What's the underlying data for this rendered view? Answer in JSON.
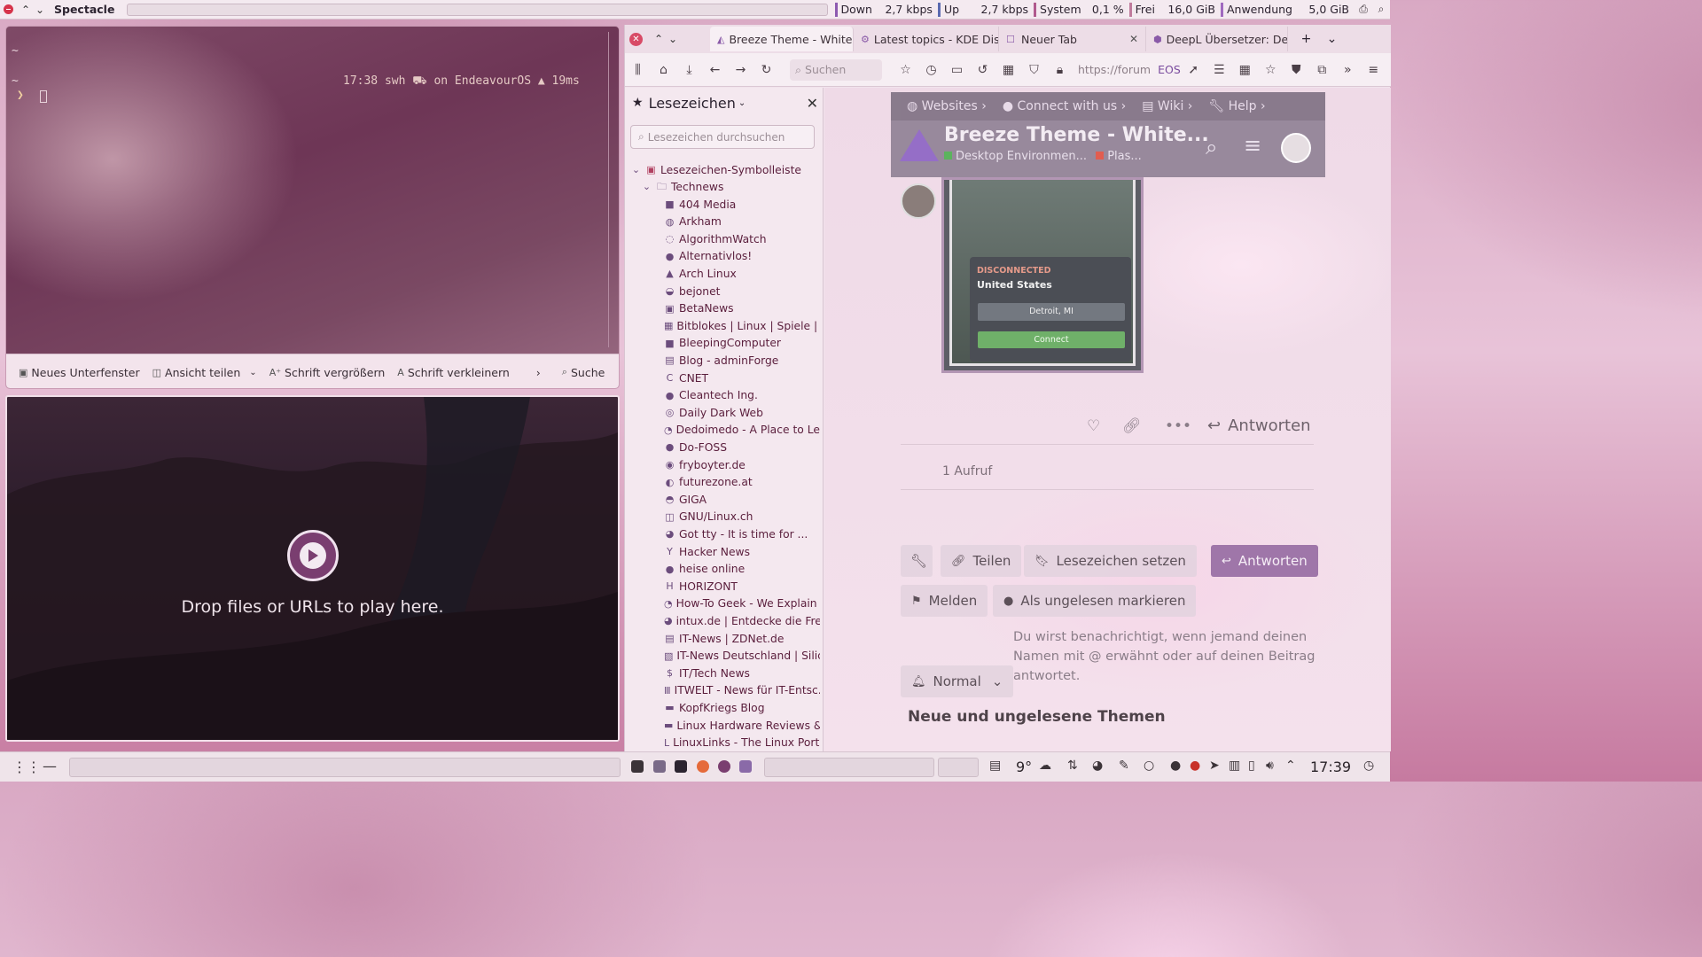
{
  "toppanel": {
    "title": "Spectacle",
    "segments": [
      {
        "label": "Down",
        "value": "2,7 kbps",
        "color": "#8d5ab0"
      },
      {
        "label": "Up",
        "value": "2,7 kbps",
        "color": "#5a6ab0"
      },
      {
        "label": "System",
        "value": "0,1 %",
        "color": "#b05a8d"
      },
      {
        "label": "Frei",
        "value": "16,0 GiB",
        "color": "#c07a9c"
      },
      {
        "label": "Anwendung",
        "value": "5,0 GiB",
        "color": "#a06abf"
      }
    ]
  },
  "terminal": {
    "tilde1": "~",
    "tilde2": "~",
    "prompt_right": "17:38 swh ⛟ on EndeavourOS ▲ 19ms",
    "prompt_arrow": "❯",
    "toolbar": {
      "new_split": "Neues Unterfenster",
      "split_view": "Ansicht teilen",
      "zoom_in": "Schrift vergrößern",
      "zoom_out": "Schrift verkleinern",
      "search": "Suche"
    }
  },
  "player": {
    "drop_text": "Drop files or URLs to play here."
  },
  "browser": {
    "tabs": [
      {
        "label": "Breeze Theme - White",
        "icon": "breeze-icon"
      },
      {
        "label": "Latest topics - KDE Dis",
        "icon": "kde-icon"
      },
      {
        "label": "Neuer Tab",
        "icon": "newtab-icon"
      },
      {
        "label": "DeepL Übersetzer: Der",
        "icon": "deepl-icon"
      }
    ],
    "search_placeholder": "Suchen",
    "url": "https://forum",
    "url_badge": "EOS"
  },
  "bookmarks": {
    "title": "Lesezeichen",
    "search_placeholder": "Lesezeichen durchsuchen",
    "root": "Lesezeichen-Symbolleiste",
    "folder": "Technews",
    "items": [
      "404 Media",
      "Arkham",
      "AlgorithmWatch",
      "Alternativlos!",
      "Arch Linux",
      "bejonet",
      "BetaNews",
      "Bitblokes | Linux | Spiele | St.",
      "BleepingComputer",
      "Blog - adminForge",
      "CNET",
      "Cleantech Ing.",
      "Daily Dark Web",
      "Dedoimedo - A Place to Lea.",
      "Do-FOSS",
      "fryboyter.de",
      "futurezone.at",
      "GIGA",
      "GNU/Linux.ch",
      "Got tty - It is time for ...",
      "Hacker News",
      "heise online",
      "HORIZONT",
      "How-To Geek - We Explain T.",
      "intux.de | Entdecke die Freih",
      "IT-News | ZDNet.de",
      "IT-News Deutschland | Silic...",
      "IT/Tech News",
      "ITWELT - News für IT-Entsc...",
      "KopfKriegs Blog",
      "Linux Hardware Reviews & ..",
      "LinuxLinks - The Linux Porta"
    ]
  },
  "forum": {
    "nav": [
      "Websites",
      "Connect with us",
      "Wiki",
      "Help"
    ],
    "title": "Breeze Theme - White...",
    "category1": "Desktop Environmen...",
    "category2": "Plas...",
    "vpn": {
      "status": "DISCONNECTED",
      "country": "United States",
      "location": "Detroit, MI",
      "connect": "Connect"
    },
    "reply_link": "Antworten",
    "views": "1 Aufruf",
    "buttons": {
      "share": "Teilen",
      "bookmark": "Lesezeichen setzen",
      "reply": "Antworten",
      "flag": "Melden",
      "mark_unread": "Als ungelesen markieren",
      "notify": "Normal"
    },
    "notify_text": "Du wirst benachrichtigt, wenn jemand deinen Namen mit @ erwähnt oder auf deinen Beitrag antwortet.",
    "new_topics": "Neue und ungelesene Themen"
  },
  "taskbar": {
    "temperature": "9°",
    "clock": "17:39"
  }
}
